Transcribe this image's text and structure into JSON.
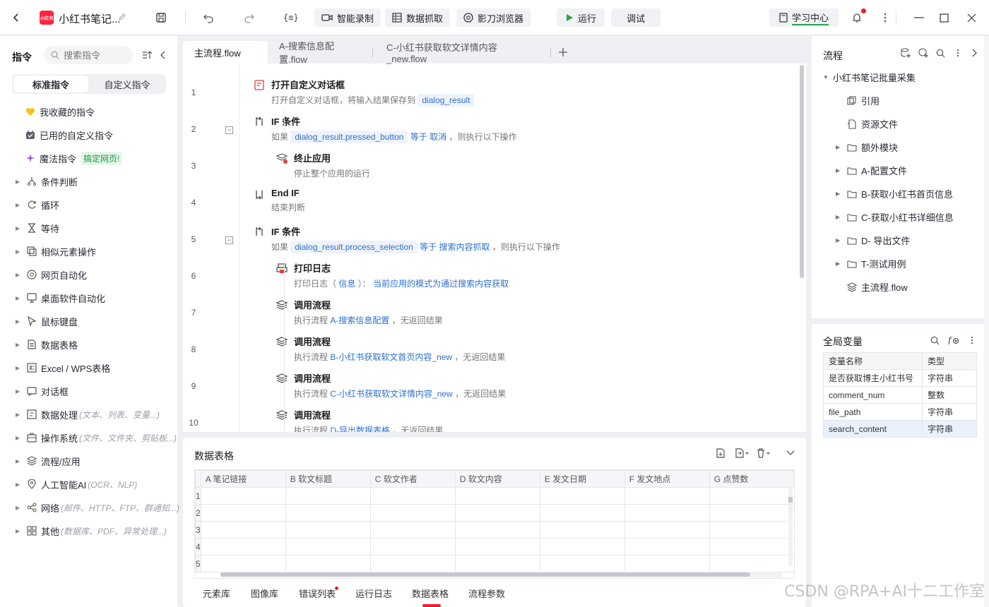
{
  "titlebar": {
    "app_logo_text": "小红书",
    "title": "小红书笔记...",
    "smart_record": "智能录制",
    "data_capture": "数据抓取",
    "browser": "影刀浏览器",
    "run": "运行",
    "debug": "调试",
    "learning_center": "学习中心"
  },
  "left": {
    "title": "指令",
    "search_placeholder": "搜索指令",
    "tab_standard": "标准指令",
    "tab_custom": "自定义指令",
    "favorites": "我收藏的指令",
    "used_custom": "已用的自定义指令",
    "magic": "魔法指令",
    "magic_badge": "搞定网页!",
    "groups": [
      {
        "label": "条件判断",
        "hint": ""
      },
      {
        "label": "循环",
        "hint": ""
      },
      {
        "label": "等待",
        "hint": ""
      },
      {
        "label": "相似元素操作",
        "hint": ""
      },
      {
        "label": "网页自动化",
        "hint": ""
      },
      {
        "label": "桌面软件自动化",
        "hint": ""
      },
      {
        "label": "鼠标键盘",
        "hint": ""
      },
      {
        "label": "数据表格",
        "hint": ""
      },
      {
        "label": "Excel / WPS表格",
        "hint": ""
      },
      {
        "label": "对话框",
        "hint": ""
      },
      {
        "label": "数据处理",
        "hint": "(文本、列表、变量...)"
      },
      {
        "label": "操作系统",
        "hint": "(文件、文件夹、剪贴板...)"
      },
      {
        "label": "流程/应用",
        "hint": ""
      },
      {
        "label": "人工智能AI",
        "hint": "(OCR、NLP)"
      },
      {
        "label": "网络",
        "hint": "(邮件、HTTP、FTP、群通知...)"
      },
      {
        "label": "其他",
        "hint": "(数据库、PDF、异常处理...)"
      }
    ]
  },
  "editor": {
    "tabs": [
      "主流程.flow",
      "A-搜索信息配置.flow",
      "C-小红书获取软文详情内容_new.flow"
    ],
    "line_numbers": [
      "1",
      "2",
      "3",
      "4",
      "5",
      "6",
      "7",
      "8",
      "9",
      "10"
    ],
    "steps": [
      {
        "title": "打开自定义对话框",
        "d1": "打开自定义对话框，将输入结果保存到",
        "chip": "dialog_result"
      },
      {
        "title": "IF 条件",
        "pre": "如果",
        "chip": "dialog_result.pressed_button",
        "op": "等于",
        "val": "取消",
        "post": "，则执行以下操作"
      },
      {
        "title": "终止应用",
        "d1": "停止整个应用的运行"
      },
      {
        "title": "End IF",
        "d1": "结束判断"
      },
      {
        "title": "IF 条件",
        "pre": "如果",
        "chip": "dialog_result.process_selection",
        "op": "等于",
        "val": "搜索内容抓取",
        "post": "，则执行以下操作"
      },
      {
        "title": "打印日志",
        "pre": "打印日志（",
        "level": "信息",
        "mid": "）：",
        "val": "当前应用的模式为通过搜索内容获取"
      },
      {
        "title": "调用流程",
        "pre": "执行流程",
        "val": "A-搜索信息配置",
        "post": "，无返回结果"
      },
      {
        "title": "调用流程",
        "pre": "执行流程",
        "val": "B-小红书获取软文首页内容_new",
        "post": "，无返回结果"
      },
      {
        "title": "调用流程",
        "pre": "执行流程",
        "val": "C-小红书获取软文详情内容_new",
        "post": "，无返回结果"
      },
      {
        "title": "调用流程",
        "pre": "执行流程",
        "val": "D-导出数据表格",
        "post": "，无返回结果"
      }
    ]
  },
  "bottom": {
    "title": "数据表格",
    "columns": [
      "A 笔记链接",
      "B 软文标题",
      "C 软文作者",
      "D 软文内容",
      "E 发文日期",
      "F 发文地点",
      "G 点赞数"
    ],
    "rows": [
      "1",
      "2",
      "3",
      "4",
      "5"
    ],
    "tabs": [
      "元素库",
      "图像库",
      "错误列表",
      "运行日志",
      "数据表格",
      "流程参数"
    ]
  },
  "right": {
    "title": "流程",
    "root": "小红书笔记批量采集",
    "items": [
      "引用",
      "资源文件",
      "额外模块",
      "A-配置文件",
      "B-获取小红书首页信息",
      "C-获取小红书详细信息",
      "D- 导出文件",
      "T-测试用例",
      "主流程.flow"
    ],
    "vars_title": "全局变量",
    "var_header": [
      "变量名称",
      "类型"
    ],
    "vars": [
      [
        "是否获取博主小红书号",
        "字符串"
      ],
      [
        "comment_num",
        "整数"
      ],
      [
        "file_path",
        "字符串"
      ],
      [
        "search_content",
        "字符串"
      ]
    ]
  },
  "watermark": "CSDN @RPA+AI十二工作室",
  "colors": {
    "accent": "#2c6fce",
    "badge_green": "#1a9b3f",
    "logo_red": "#ff2442"
  }
}
